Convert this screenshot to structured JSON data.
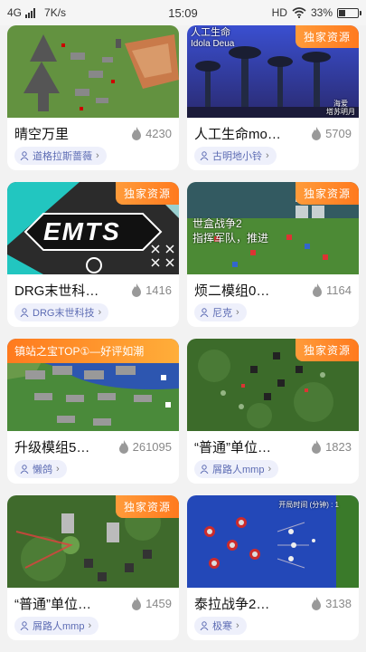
{
  "status_bar": {
    "network": "4G",
    "speed": "7K/s",
    "time": "15:09",
    "hd": "HD",
    "battery": "33%",
    "battery_level": 0.33
  },
  "badge_exclusive": "独家资源",
  "cards": [
    {
      "title": "晴空万里",
      "popularity": "4230",
      "author": "道格拉斯蔷薇"
    },
    {
      "title": "人工生命mo…",
      "popularity": "5709",
      "author": "古明地小铃",
      "thumb_caption_top": "人工生命",
      "thumb_caption_sub": "Idola Deua",
      "thumb_caption_bottom": "海爱\n塔苏明月",
      "exclusive": true
    },
    {
      "title": "DRG末世科…",
      "popularity": "1416",
      "author": "DRG末世科技",
      "thumb_logo": "EMTS",
      "exclusive": true
    },
    {
      "title": "烦二模组0…",
      "popularity": "1164",
      "author": "尼克",
      "thumb_caption_line1": "世盒战争2",
      "thumb_caption_line2": "指挥军队，推进",
      "exclusive": true
    },
    {
      "title": "升级模组5…",
      "popularity": "261095",
      "author": "懒鸽",
      "banner": "镇站之宝TOP①—好评如潮"
    },
    {
      "title": "“普通”单位…",
      "popularity": "1823",
      "author": "屑路人mmp",
      "exclusive": true
    },
    {
      "title": "“普通”单位…",
      "popularity": "1459",
      "author": "屑路人mmp",
      "exclusive": true
    },
    {
      "title": "泰拉战争2…",
      "popularity": "3138",
      "author": "极寒",
      "thumb_caption_line1": "开局时间 (分钟) : 1"
    }
  ]
}
